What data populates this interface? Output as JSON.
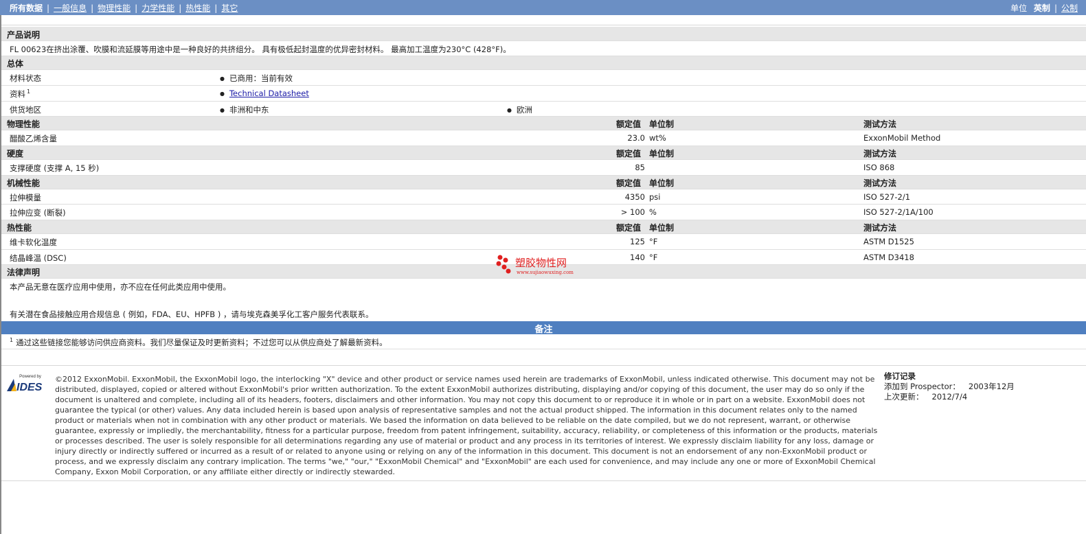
{
  "nav": {
    "items": [
      "所有数据",
      "一般信息",
      "物理性能",
      "力学性能",
      "热性能",
      "其它"
    ],
    "separator": "|",
    "units_label": "单位",
    "units_options": [
      "英制",
      "公制"
    ]
  },
  "sections": {
    "product_desc": {
      "title": "产品说明",
      "text": "FL 00623在挤出涂覆、吹膜和流延膜等用途中是一种良好的共挤组分。 具有极低起封温度的优异密封材料。 最高加工温度为230°C (428°F)。"
    },
    "general": {
      "title": "总体",
      "rows": [
        {
          "label": "材料状态",
          "values": [
            "已商用：当前有效"
          ]
        },
        {
          "label": "资料",
          "sup": "1",
          "link": "Technical Datasheet"
        },
        {
          "label": "供货地区",
          "values": [
            "非洲和中东",
            "欧洲"
          ]
        }
      ]
    },
    "col_headers": {
      "nominal": "额定值",
      "unit": "单位制",
      "method": "测试方法"
    },
    "physical": {
      "title": "物理性能",
      "rows": [
        {
          "label": "醋酸乙烯含量",
          "value": "23.0",
          "unit": "wt%",
          "method": "ExxonMobil Method"
        }
      ]
    },
    "hardness": {
      "title": "硬度",
      "rows": [
        {
          "label": "支撑硬度 (支撑 A, 15 秒)",
          "value": "85",
          "unit": "",
          "method": "ISO 868"
        }
      ]
    },
    "mechanical": {
      "title": "机械性能",
      "rows": [
        {
          "label": "拉伸模量",
          "value": "4350",
          "unit": "psi",
          "method": "ISO 527-2/1"
        },
        {
          "label": "拉伸应变 (断裂)",
          "value": "> 100",
          "unit": "%",
          "method": "ISO 527-2/1A/100"
        }
      ]
    },
    "thermal": {
      "title": "热性能",
      "rows": [
        {
          "label": "维卡软化温度",
          "value": "125",
          "unit": "°F",
          "method": "ASTM D1525"
        },
        {
          "label": "结晶峰温 (DSC)",
          "value": "140",
          "unit": "°F",
          "method": "ASTM D3418"
        }
      ]
    },
    "legal": {
      "title": "法律声明",
      "line1": "本产品无意在医疗应用中使用，亦不应在任何此类应用中使用。",
      "line2": "有关潜在食品接触应用合规信息 ( 例如，FDA、EU、HPFB ) ，请与埃克森美孚化工客户服务代表联系。"
    }
  },
  "notes": {
    "title": "备注",
    "sup": "1",
    "text": "通过这些链接您能够访问供应商资料。我们尽量保证及时更新资料；不过您可以从供应商处了解最新资料。"
  },
  "footer": {
    "logo_small": "Powered by",
    "logo_main": "IDES",
    "copyright": "©2012 ExxonMobil. ExxonMobil, the ExxonMobil logo, the interlocking \"X\" device and other product or service names used herein are trademarks of ExxonMobil, unless indicated otherwise. This document may not be distributed, displayed, copied or altered without ExxonMobil's prior written authorization. To the extent ExxonMobil authorizes distributing, displaying and/or copying of this document, the user may do so only if the document is unaltered and complete, including all of its headers, footers, disclaimers and other information. You may not copy this document to or reproduce it in whole or in part on a website. ExxonMobil does not guarantee the typical (or other) values. Any data included herein is based upon analysis of representative samples and not the actual product shipped. The information in this document relates only to the named product or materials when not in combination with any other product or materials. We based the information on data believed to be reliable on the date compiled, but we do not represent, warrant, or otherwise guarantee, expressly or impliedly, the merchantability, fitness for a particular purpose, freedom from patent infringement, suitability, accuracy, reliability, or completeness of this information or the products, materials or processes described. The user is solely responsible for all determinations regarding any use of material or product and any process in its territories of interest. We expressly disclaim liability for any loss, damage or injury directly or indirectly suffered or incurred as a result of or related to anyone using or relying on any of the information in this document. This document is not an endorsement of any non-ExxonMobil product or process, and we expressly disclaim any contrary implication. The terms \"we,\" \"our,\" \"ExxonMobil Chemical\" and \"ExxonMobil\" are each used for convenience, and may include any one or more of ExxonMobil Chemical Company, Exxon Mobil Corporation, or any affiliate either directly or indirectly stewarded.",
    "revision_title": "修订记录",
    "added_label": "添加到 Prospector：",
    "added_value": "2003年12月",
    "updated_label": "上次更新：",
    "updated_value": "2012/7/4"
  },
  "watermark": {
    "text": "塑胶物性网",
    "url": "www.sujiaowuxing.com"
  },
  "colors": {
    "topbar": "#6b8fc4",
    "notes_bar": "#4f7fc0",
    "header_row": "#e6e6e6",
    "watermark": "#e02020"
  }
}
